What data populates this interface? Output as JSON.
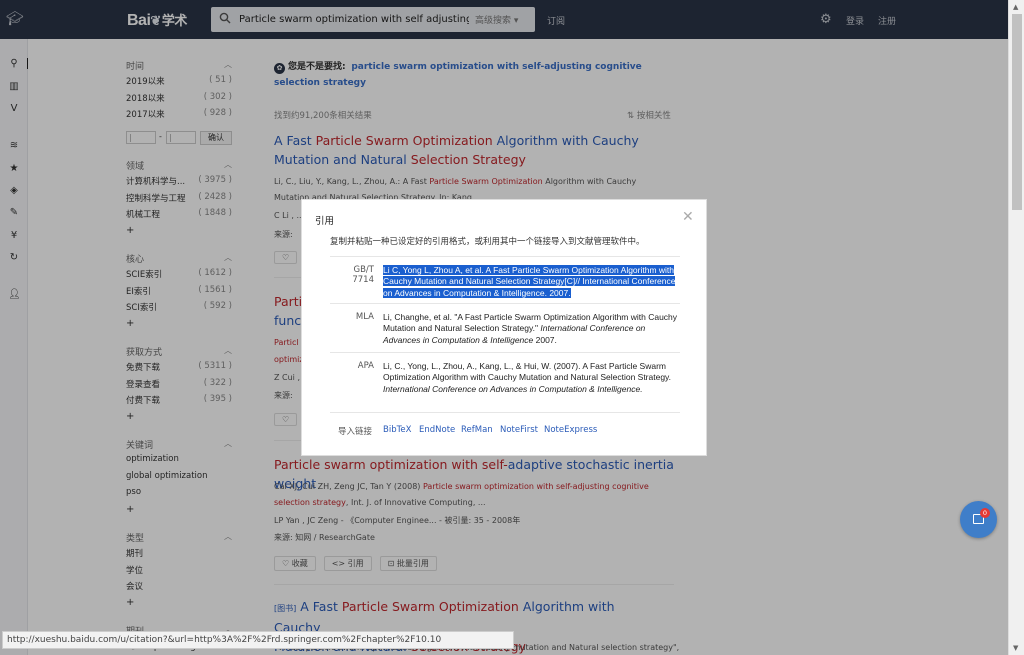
{
  "header": {
    "logo_text": "Bai",
    "logo_suffix": "学术",
    "search_value": "Particle swarm optimization with self adjusting",
    "advanced_search": "高级搜索 ▾",
    "subscribe": "订阅",
    "login": "登录",
    "register": "注册"
  },
  "filters": {
    "time": {
      "title": "时间",
      "items": [
        {
          "label": "2019以来",
          "count": "( 51 )"
        },
        {
          "label": "2018以来",
          "count": "( 302 )"
        },
        {
          "label": "2017以来",
          "count": "( 928 )"
        }
      ],
      "confirm": "确认",
      "dash": "-"
    },
    "field": {
      "title": "领域",
      "items": [
        {
          "label": "计算机科学与...",
          "count": "( 3975 )"
        },
        {
          "label": "控制科学与工程",
          "count": "( 2428 )"
        },
        {
          "label": "机械工程",
          "count": "( 1848 )"
        }
      ]
    },
    "core": {
      "title": "核心",
      "items": [
        {
          "label": "SCIE索引",
          "count": "( 1612 )"
        },
        {
          "label": "EI索引",
          "count": "( 1561 )"
        },
        {
          "label": "SCI索引",
          "count": "( 592 )"
        }
      ]
    },
    "access": {
      "title": "获取方式",
      "items": [
        {
          "label": "免费下载",
          "count": "( 5311 )"
        },
        {
          "label": "登录查看",
          "count": "( 322 )"
        },
        {
          "label": "付费下载",
          "count": "( 395 )"
        }
      ]
    },
    "keywords": {
      "title": "关键词",
      "items": [
        {
          "label": "optimization"
        },
        {
          "label": "global optimization"
        },
        {
          "label": "pso"
        }
      ]
    },
    "type": {
      "title": "类型",
      "items": [
        {
          "label": "期刊"
        },
        {
          "label": "学位"
        },
        {
          "label": "会议"
        }
      ]
    },
    "journal": {
      "title": "期刊",
      "items": [
        {
          "label": "《Computer Engin..."
        }
      ]
    },
    "plus": "+"
  },
  "results": {
    "suggest_prefix": "您是不是要找:",
    "suggest_link": "particle swarm optimization with self-adjusting cognitive selection strategy",
    "found": "找到约91,200条相关结果",
    "sort": "按相关性",
    "r1": {
      "title_parts": [
        "A Fast ",
        "Particle Swarm Optimization",
        " Algorithm with Cauchy Mutation and Natural ",
        "Selection Strategy"
      ],
      "authors": "Li, C., Liu, Y., Kang, L., Zhou, A.: A Fast ",
      "authors_hl": "Particle Swarm Optimization",
      "authors_tail": " Algorithm with Cauchy",
      "line2": "Mutation and Natural Selection Strategy. In: Kang...",
      "line3": "C Li , ...",
      "line4": "来源:"
    },
    "r2": {
      "title_a": "Partic",
      "title_b": "functi",
      "meta_a": "Particl",
      "meta_b": "optimiz",
      "meta_c": "Z Cui ,",
      "meta_d": "来源:"
    },
    "r3": {
      "title_hl": "Particle swarm optimization with self-",
      "title_rest": "adaptive stochastic inertia weight",
      "line1": "Cai XJ, Cui ZH, Zeng JC, Tan Y (2008) ",
      "line1_hl": "Particle swarm optimization with self-adjusting cognitive",
      "line2_hl": "selection strategy",
      "line2_rest": ", Int. J. of Innovative Computing, ...",
      "line3": "LP Yan ,    JC Zeng  -  《Computer Enginee...  -  被引量:  35  -  2008年",
      "line4": "来源:  知网  /  ResearchGate",
      "btn_save": "♡ 收藏",
      "btn_cite": "<> 引用",
      "btn_batch": "⊡ 批量引用"
    },
    "r4": {
      "tag": "[图书]",
      "title_a": " A Fast ",
      "title_hl1": "Particle Swarm Optimization",
      "title_b": " Algorithm with Cauchy",
      "title_c": "Mutation and Natural ",
      "title_hl2": "Selection Strategy",
      "meta": "A fast particle swarm optimization algorithm with Cauchy mutation and Natural selection strategy\","
    }
  },
  "modal": {
    "title": "引用",
    "desc": "复制并粘贴一种已设定好的引用格式，或利用其中一个链接导入到文献管理软件中。",
    "gbt_label": "GB/T 7714",
    "gbt_text": "Li C, Yong L, Zhou A, et al. A Fast Particle Swarm Optimization Algorithm with Cauchy Mutation and Natural Selection Strategy[C]// International Conference on Advances in Computation & Intelligence. 2007.",
    "mla_label": "MLA",
    "mla_text": "Li, Changhe, et al. \"A Fast Particle Swarm Optimization Algorithm with Cauchy Mutation and Natural Selection Strategy.\" ",
    "mla_italic": "International Conference on Advances in Computation & Intelligence",
    "mla_tail": " 2007.",
    "apa_label": "APA",
    "apa_text": "Li, C., Yong, L., Zhou, A., Kang, L., & Hui, W. (2007). A Fast Particle Swarm Optimization Algorithm with Cauchy Mutation and Natural Selection Strategy. ",
    "apa_italic": "International Conference on Advances in Computation & Intelligence.",
    "import_label": "导入链接",
    "links": [
      "BibTeX",
      "EndNote",
      "RefMan",
      "NoteFirst",
      "NoteExpress"
    ],
    "close": "✕"
  },
  "fab_badge": "0",
  "status_url": "http://xueshu.baidu.com/u/citation?&url=http%3A%2F%2Frd.springer.com%2Fchapter%2F10.10",
  "colors": {
    "topbar": "#2a3447",
    "link": "#2a5bb8",
    "highlight": "#c0272d",
    "selection": "#1a5fcf"
  }
}
